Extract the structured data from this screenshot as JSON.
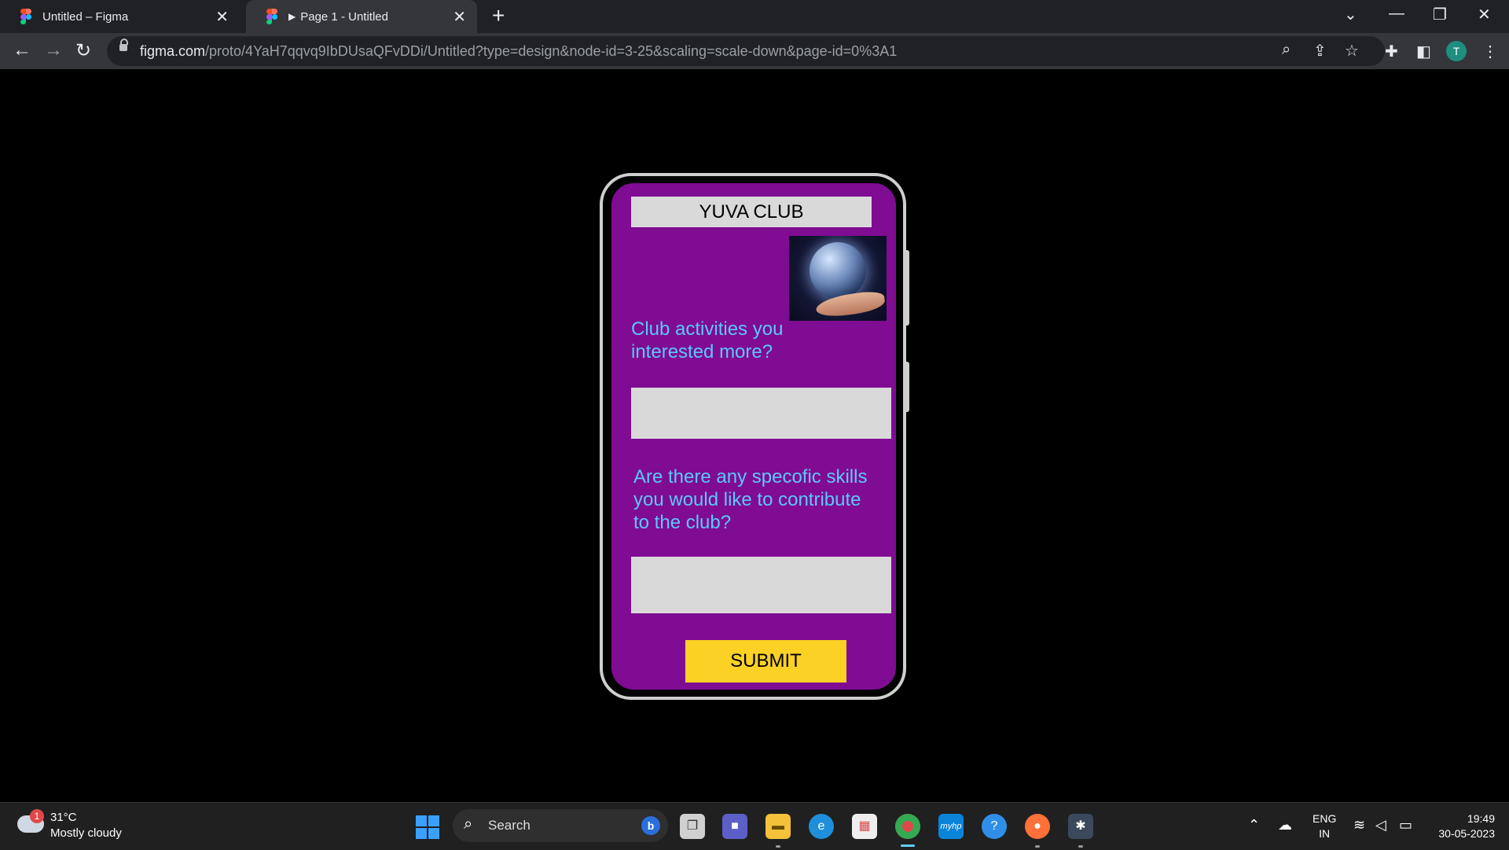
{
  "browser": {
    "tabs": [
      {
        "label": "Untitled – Figma",
        "active": false
      },
      {
        "label": "Page 1 - Untitled",
        "active": true
      }
    ],
    "url_host": "figma.com",
    "url_path": "/proto/4YaH7qqvq9IbDUsaQFvDDi/Untitled?type=design&node-id=3-25&scaling=scale-down&page-id=0%3A1",
    "profile_initial": "T"
  },
  "prototype": {
    "title": "YUVA CLUB",
    "question1": "Club activities you interested more?",
    "question2": "Are there any specofic skills you would like to contribute to the club?",
    "answer1": "",
    "answer2": "",
    "submit_label": "SUBMIT",
    "colors": {
      "screen_bg": "#800c93",
      "question_text": "#5ac8fa",
      "field_bg": "#d9d9d9",
      "submit_bg": "#fbd126"
    }
  },
  "taskbar": {
    "weather_badge": "1",
    "temperature": "31°C",
    "condition": "Mostly cloudy",
    "search_label": "Search",
    "language_line1": "ENG",
    "language_line2": "IN",
    "time": "19:49",
    "date": "30-05-2023",
    "apps": [
      "task-view",
      "teams",
      "file-explorer",
      "edge",
      "store",
      "chrome",
      "myhp",
      "help",
      "firefox",
      "other-app"
    ],
    "myhp_label": "myhp"
  }
}
